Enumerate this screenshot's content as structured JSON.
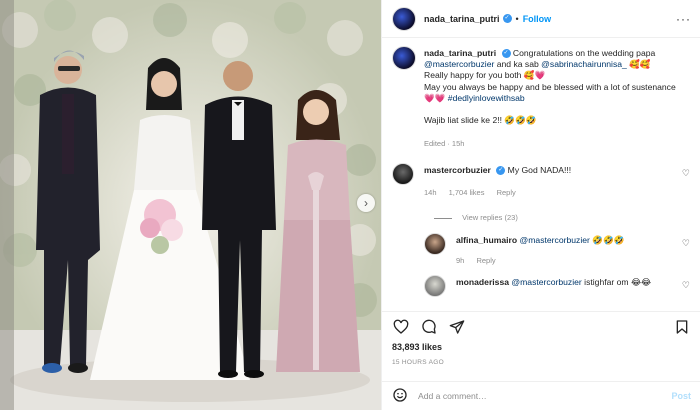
{
  "post": {
    "username": "nada_tarina_putri",
    "follow_label": "Follow",
    "dot": "•",
    "more_label": "···"
  },
  "caption": {
    "username": "nada_tarina_putri",
    "line1": "Congratulations on the wedding papa",
    "mention1": "@mastercorbuzier",
    "line2a": "and ka sab",
    "mention2": "@sabrinachairunnisa_",
    "emoji1": "🥰🥰",
    "line3": "Really happy for you both",
    "emoji2": "🥰💗",
    "line4": "May you always be happy and be blessed with a lot of sustenance",
    "emoji3": "💗💗",
    "hashtag": "#dedlyinlovewithsab",
    "line5": "Wajib liat slide ke 2!!",
    "emoji4": "🤣🤣🤣",
    "edited": "Edited · 15h"
  },
  "comments": [
    {
      "username": "mastercorbuzier",
      "text": "My God NADA!!!",
      "time": "14h",
      "likes": "1,704 likes",
      "reply": "Reply",
      "view_replies": "View replies (23)"
    },
    {
      "username": "alfina_humairo",
      "mention": "@mastercorbuzier",
      "emoji": "🤣🤣🤣",
      "time": "9h",
      "reply": "Reply"
    },
    {
      "username": "monaderissa",
      "mention": "@mastercorbuzier",
      "text": "istighfar om",
      "emoji": "😂😂"
    }
  ],
  "likes": "83,893 likes",
  "time_ago": "15 HOURS AGO",
  "add_comment": {
    "placeholder": "Add a comment…",
    "post_label": "Post"
  },
  "icons": {
    "verified": "check-badge-icon",
    "heart": "heart-icon",
    "comment": "comment-icon",
    "share": "share-icon",
    "save": "bookmark-icon",
    "emoji": "smiley-icon",
    "next": "chevron-right-icon",
    "more": "more-dots-icon"
  },
  "colors": {
    "accent": "#0095f6",
    "link": "#00376b",
    "muted": "#8e8e8e",
    "verified": "#3897f0"
  }
}
